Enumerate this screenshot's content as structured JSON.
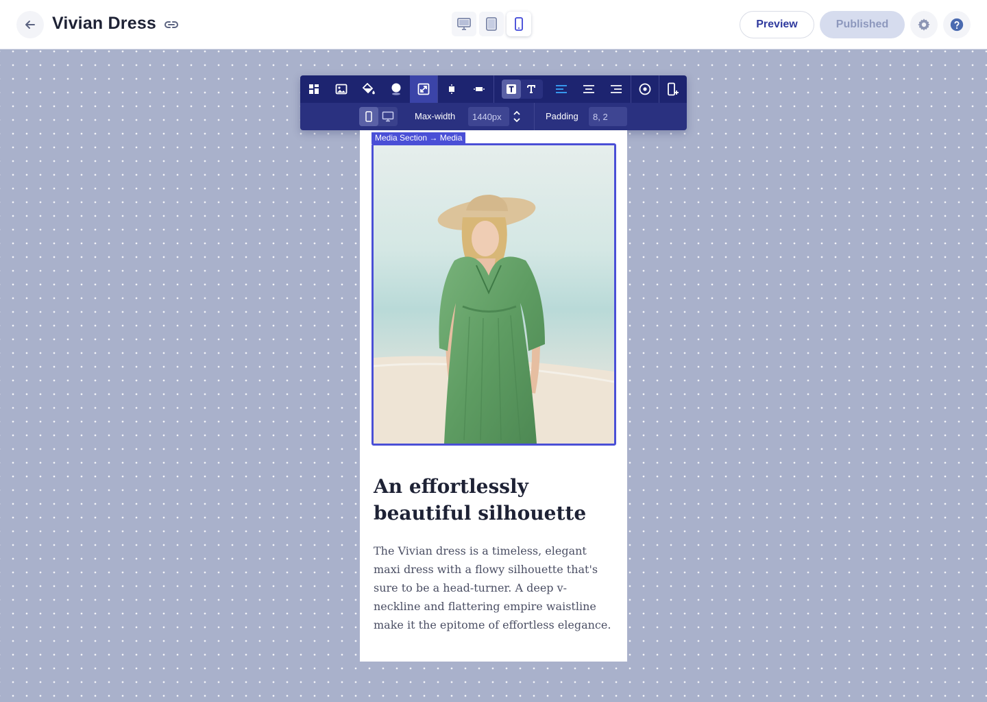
{
  "topbar": {
    "back_icon": "arrow-left-icon",
    "title": "Vivian Dress",
    "link_icon": "link-icon",
    "devices": [
      "desktop-icon",
      "tablet-icon",
      "mobile-icon"
    ],
    "active_device": "mobile",
    "preview_label": "Preview",
    "published_label": "Published",
    "settings_icon": "gear-icon",
    "help_icon": "help-icon"
  },
  "toolbar": {
    "tools": [
      "layout-icon",
      "image-icon",
      "fill-icon",
      "shadow-icon",
      "resize-icon",
      "align-small-icon",
      "align-wide-icon",
      "text-style-solid-icon",
      "text-style-outline-icon",
      "align-left-icon",
      "align-center-icon",
      "align-right-icon",
      "target-icon",
      "add-section-icon"
    ],
    "active_tool": "resize-icon",
    "max_width_label": "Max-width",
    "max_width_value": "1440px",
    "padding_label": "Padding",
    "padding_value": "8, 2"
  },
  "canvas": {
    "selection_label": "Media Section → Media",
    "headline": "An effortlessly beautiful silhouette",
    "body": "The Vivian dress is a timeless, elegant maxi dress with a flowy silhouette that's sure to be a head-turner. A deep v-neckline and flattering empire waistline make it the epitome of effortless elegance."
  },
  "colors": {
    "accent": "#4a4fd6",
    "toolbar_bg": "#1d2470",
    "canvas_bg": "#a9b1cb",
    "dress_green": "#5f9e64"
  }
}
